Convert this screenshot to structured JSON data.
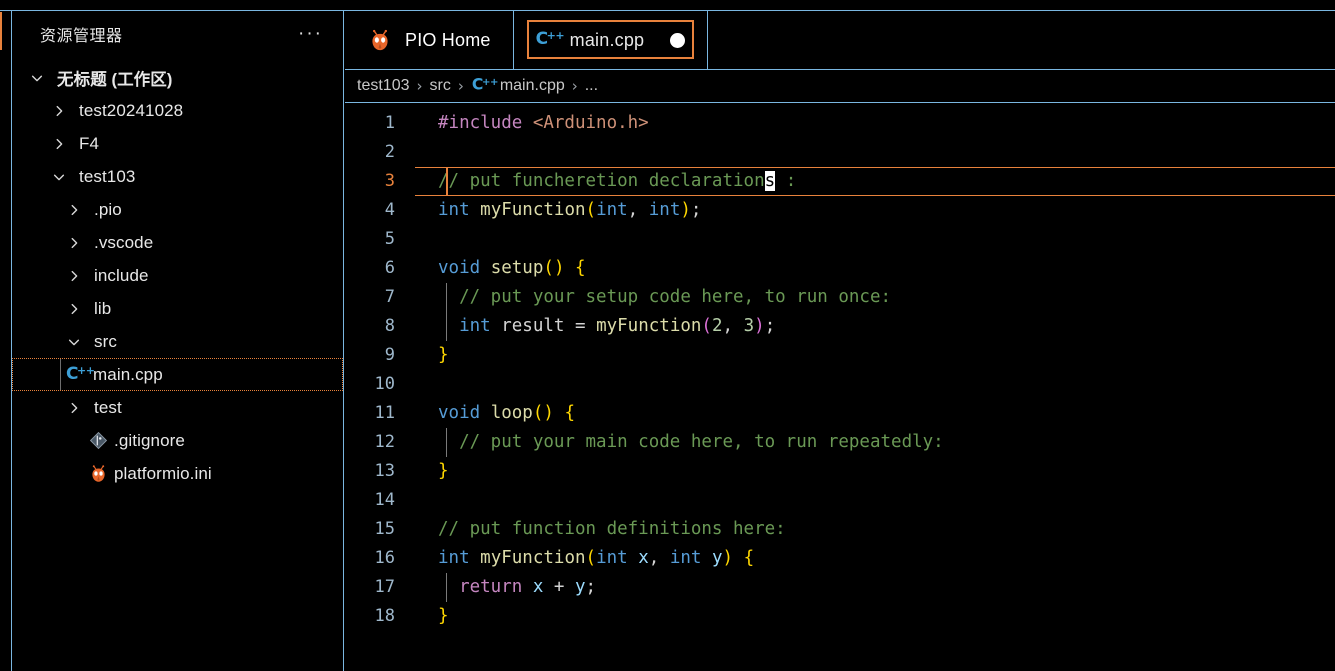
{
  "window": {
    "accent_orange": "#e8823c",
    "focus_blue": "#7ab6e0",
    "background": "#000000"
  },
  "sidebar": {
    "title": "资源管理器",
    "more_icon": "ellipsis-icon",
    "more_label": "···",
    "tree": [
      {
        "label": "无标题 (工作区)",
        "kind": "workspace",
        "expanded": true,
        "indent": 0,
        "icon": "none"
      },
      {
        "label": "test20241028",
        "kind": "folder",
        "expanded": false,
        "indent": 1,
        "icon": "none"
      },
      {
        "label": "F4",
        "kind": "folder",
        "expanded": false,
        "indent": 1,
        "icon": "none"
      },
      {
        "label": "test103",
        "kind": "folder",
        "expanded": true,
        "indent": 1,
        "icon": "none"
      },
      {
        "label": ".pio",
        "kind": "folder",
        "expanded": false,
        "indent": 2,
        "icon": "none"
      },
      {
        "label": ".vscode",
        "kind": "folder",
        "expanded": false,
        "indent": 2,
        "icon": "none"
      },
      {
        "label": "include",
        "kind": "folder",
        "expanded": false,
        "indent": 2,
        "icon": "none"
      },
      {
        "label": "lib",
        "kind": "folder",
        "expanded": false,
        "indent": 2,
        "icon": "none"
      },
      {
        "label": "src",
        "kind": "folder",
        "expanded": true,
        "indent": 2,
        "icon": "none"
      },
      {
        "label": "main.cpp",
        "kind": "file",
        "expanded": null,
        "indent": 3,
        "icon": "cpp-file-icon",
        "focused": true
      },
      {
        "label": "test",
        "kind": "folder",
        "expanded": false,
        "indent": 2,
        "icon": "none"
      },
      {
        "label": ".gitignore",
        "kind": "file",
        "expanded": null,
        "indent": 2,
        "icon": "git-file-icon"
      },
      {
        "label": "platformio.ini",
        "kind": "file",
        "expanded": null,
        "indent": 2,
        "icon": "platformio-icon"
      }
    ]
  },
  "tabs": [
    {
      "label": "PIO Home",
      "icon": "platformio-icon",
      "active": false,
      "dirty": false
    },
    {
      "label": "main.cpp",
      "icon": "cpp-file-icon",
      "active": true,
      "dirty": true
    }
  ],
  "breadcrumbs": [
    {
      "label": "test103",
      "icon": "none"
    },
    {
      "label": "src",
      "icon": "none"
    },
    {
      "label": "main.cpp",
      "icon": "cpp-file-icon"
    },
    {
      "label": "...",
      "icon": "none"
    }
  ],
  "breadcrumb_separator": "›",
  "editor": {
    "active_line": 3,
    "cursor_char": "s",
    "lines": [
      {
        "n": "1",
        "indent_guide": false,
        "tokens": [
          {
            "t": "#include ",
            "c": "t-pre"
          },
          {
            "t": "<Arduino.h>",
            "c": "t-str"
          }
        ]
      },
      {
        "n": "2",
        "indent_guide": false,
        "tokens": []
      },
      {
        "n": "3",
        "indent_guide": false,
        "active": true,
        "tokens": [
          {
            "t": "// put funcheretion declaration",
            "c": "t-cmt"
          },
          {
            "t": "s",
            "c": "t-cmt cursor-block"
          },
          {
            "t": " :",
            "c": "t-cmt"
          }
        ]
      },
      {
        "n": "4",
        "indent_guide": false,
        "tokens": [
          {
            "t": "int",
            "c": "t-type"
          },
          {
            "t": " ",
            "c": "t-plain"
          },
          {
            "t": "myFunction",
            "c": "t-fn"
          },
          {
            "t": "(",
            "c": "t-br1"
          },
          {
            "t": "int",
            "c": "t-type"
          },
          {
            "t": ", ",
            "c": "t-plain"
          },
          {
            "t": "int",
            "c": "t-type"
          },
          {
            "t": ")",
            "c": "t-br1"
          },
          {
            "t": ";",
            "c": "t-plain"
          }
        ]
      },
      {
        "n": "5",
        "indent_guide": false,
        "tokens": []
      },
      {
        "n": "6",
        "indent_guide": false,
        "tokens": [
          {
            "t": "void",
            "c": "t-kw"
          },
          {
            "t": " ",
            "c": "t-plain"
          },
          {
            "t": "setup",
            "c": "t-fn"
          },
          {
            "t": "(",
            "c": "t-br1"
          },
          {
            "t": ")",
            "c": "t-br1"
          },
          {
            "t": " ",
            "c": "t-plain"
          },
          {
            "t": "{",
            "c": "t-br1"
          }
        ]
      },
      {
        "n": "7",
        "indent_guide": true,
        "tokens": [
          {
            "t": "  // put your setup code here, to run once:",
            "c": "t-cmt"
          }
        ]
      },
      {
        "n": "8",
        "indent_guide": true,
        "tokens": [
          {
            "t": "  ",
            "c": "t-plain"
          },
          {
            "t": "int",
            "c": "t-type"
          },
          {
            "t": " result ",
            "c": "t-plain"
          },
          {
            "t": "= ",
            "c": "t-plain"
          },
          {
            "t": "myFunction",
            "c": "t-fn"
          },
          {
            "t": "(",
            "c": "t-br2"
          },
          {
            "t": "2",
            "c": "t-num"
          },
          {
            "t": ", ",
            "c": "t-plain"
          },
          {
            "t": "3",
            "c": "t-num"
          },
          {
            "t": ")",
            "c": "t-br2"
          },
          {
            "t": ";",
            "c": "t-plain"
          }
        ]
      },
      {
        "n": "9",
        "indent_guide": false,
        "tokens": [
          {
            "t": "}",
            "c": "t-br1"
          }
        ]
      },
      {
        "n": "10",
        "indent_guide": false,
        "tokens": []
      },
      {
        "n": "11",
        "indent_guide": false,
        "tokens": [
          {
            "t": "void",
            "c": "t-kw"
          },
          {
            "t": " ",
            "c": "t-plain"
          },
          {
            "t": "loop",
            "c": "t-fn"
          },
          {
            "t": "(",
            "c": "t-br1"
          },
          {
            "t": ")",
            "c": "t-br1"
          },
          {
            "t": " ",
            "c": "t-plain"
          },
          {
            "t": "{",
            "c": "t-br1"
          }
        ]
      },
      {
        "n": "12",
        "indent_guide": true,
        "tokens": [
          {
            "t": "  // put your main code here, to run repeatedly:",
            "c": "t-cmt"
          }
        ]
      },
      {
        "n": "13",
        "indent_guide": false,
        "tokens": [
          {
            "t": "}",
            "c": "t-br1"
          }
        ]
      },
      {
        "n": "14",
        "indent_guide": false,
        "tokens": []
      },
      {
        "n": "15",
        "indent_guide": false,
        "tokens": [
          {
            "t": "// put function definitions here:",
            "c": "t-cmt"
          }
        ]
      },
      {
        "n": "16",
        "indent_guide": false,
        "tokens": [
          {
            "t": "int",
            "c": "t-type"
          },
          {
            "t": " ",
            "c": "t-plain"
          },
          {
            "t": "myFunction",
            "c": "t-fn"
          },
          {
            "t": "(",
            "c": "t-br1"
          },
          {
            "t": "int",
            "c": "t-type"
          },
          {
            "t": " ",
            "c": "t-plain"
          },
          {
            "t": "x",
            "c": "t-var"
          },
          {
            "t": ", ",
            "c": "t-plain"
          },
          {
            "t": "int",
            "c": "t-type"
          },
          {
            "t": " ",
            "c": "t-plain"
          },
          {
            "t": "y",
            "c": "t-var"
          },
          {
            "t": ")",
            "c": "t-br1"
          },
          {
            "t": " ",
            "c": "t-plain"
          },
          {
            "t": "{",
            "c": "t-br1"
          }
        ]
      },
      {
        "n": "17",
        "indent_guide": true,
        "tokens": [
          {
            "t": "  ",
            "c": "t-plain"
          },
          {
            "t": "return",
            "c": "t-ctl"
          },
          {
            "t": " ",
            "c": "t-plain"
          },
          {
            "t": "x",
            "c": "t-var"
          },
          {
            "t": " + ",
            "c": "t-plain"
          },
          {
            "t": "y",
            "c": "t-var"
          },
          {
            "t": ";",
            "c": "t-plain"
          }
        ]
      },
      {
        "n": "18",
        "indent_guide": false,
        "tokens": [
          {
            "t": "}",
            "c": "t-br1"
          }
        ]
      }
    ]
  }
}
